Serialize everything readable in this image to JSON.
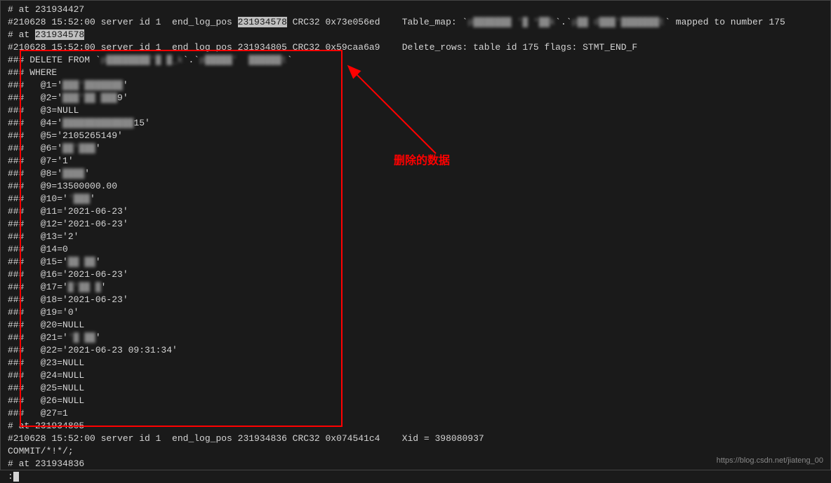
{
  "lines": {
    "l1": "# at 231934427",
    "l2_a": "#210628 15:52:00 server id 1  end_log_pos ",
    "l2_b": "231934578",
    "l2_c": " CRC32 0x73e056ed    Table_map: `",
    "l2_cen1": "p███████ '█ *██k",
    "l2_d": "`.`",
    "l2_cen2": "p██ d███'███████t",
    "l2_e": "` mapped to number 175",
    "l3_a": "# at ",
    "l3_b": "231934578",
    "l4": "#210628 15:52:00 server id 1  end_log_pos 231934805 CRC32 0x59caa6a9    Delete_rows: table id 175 flags: STMT_END_F",
    "l5_a": "### DELETE FROM `",
    "l5_cen1": "p████████'█ █_k",
    "l5_b": "`.`",
    "l5_cen2": "p█████'  ██████t",
    "l5_c": "`",
    "l6": "### WHERE",
    "l7_a": "###   @1='",
    "l7_cen": "███'███████",
    "l7_b": "'",
    "l8_a": "###   @2='",
    "l8_cen": "███'██ ███",
    "l8_b": "9'",
    "l9": "###   @3=NULL",
    "l10_a": "###   @4='",
    "l10_cen": "█████████████",
    "l10_b": "15'",
    "l11": "###   @5='2105265149'",
    "l12_a": "###   @6='",
    "l12_cen": "██'███",
    "l12_b": "'",
    "l13": "###   @7='1'",
    "l14_a": "###   @8='",
    "l14_cen": "████",
    "l14_b": "'",
    "l15": "###   @9=13500000.00",
    "l16_a": "###   @10='",
    "l16_cen": "'███",
    "l16_b": "'",
    "l17": "###   @11='2021-06-23'",
    "l18": "###   @12='2021-06-23'",
    "l19": "###   @13='2'",
    "l20": "###   @14=0",
    "l21_a": "###   @15='",
    "l21_cen": "██ ██",
    "l21_b": "'",
    "l22": "###   @16='2021-06-23'",
    "l23_a": "###   @17='",
    "l23_cen": "█'██ █",
    "l23_b": "'",
    "l24": "###   @18='2021-06-23'",
    "l25": "###   @19='0'",
    "l26": "###   @20=NULL",
    "l27_a": "###   @21='",
    "l27_cen": "'█ ██",
    "l27_b": "'",
    "l28": "###   @22='2021-06-23 09:31:34'",
    "l29": "###   @23=NULL",
    "l30": "###   @24=NULL",
    "l31": "###   @25=NULL",
    "l32": "###   @26=NULL",
    "l33": "###   @27=1",
    "l34": "# at 231934805",
    "l35": "#210628 15:52:00 server id 1  end_log_pos 231934836 CRC32 0x074541c4    Xid = 398080937",
    "l36": "COMMIT/*!*/;",
    "l37": "# at 231934836",
    "l38": ":"
  },
  "annotation": "删除的数据",
  "watermark": "https://blog.csdn.net/jiateng_00"
}
